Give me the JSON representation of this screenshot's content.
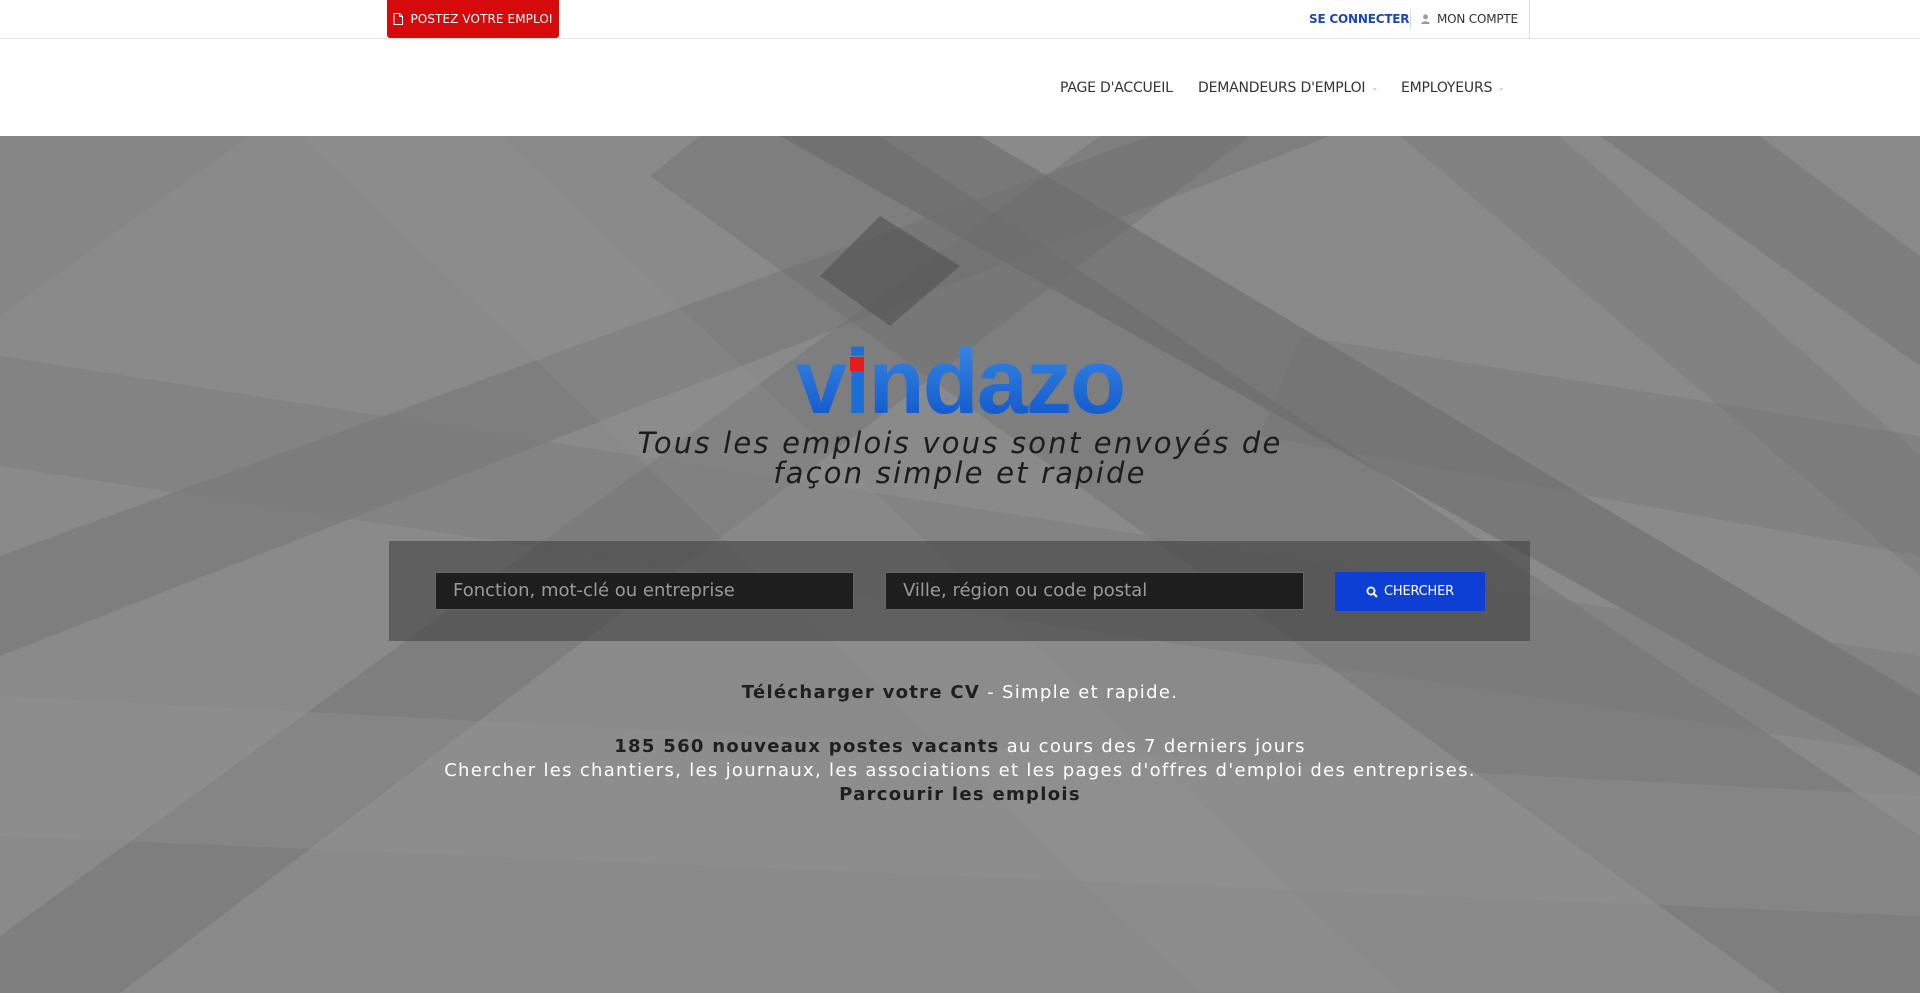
{
  "topbar": {
    "post_job_label": "POSTEZ VOTRE EMPLOI",
    "post_job_icon": "document-icon",
    "login_label": "SE CONNECTER",
    "account_label": "MON COMPTE",
    "account_icon": "user-icon"
  },
  "nav": {
    "items": [
      {
        "label": "PAGE D'ACCUEIL",
        "has_dropdown": false
      },
      {
        "label": "DEMANDEURS D'EMPLOI",
        "has_dropdown": true
      },
      {
        "label": "EMPLOYEURS",
        "has_dropdown": true
      }
    ]
  },
  "hero": {
    "logo": {
      "text_pre": "v",
      "text_i": "i",
      "text_post": "ndazo",
      "color": "#1b6fd6",
      "dot_color": "#e61b1b"
    },
    "tagline_line1": "Tous les emplois vous sont envoyés de",
    "tagline_line2": "façon simple et rapide"
  },
  "search": {
    "keyword_placeholder": "Fonction, mot-clé ou entreprise",
    "location_placeholder": "Ville, région ou code postal",
    "button_label": "CHERCHER",
    "button_icon": "search-icon",
    "button_color": "#0d3fd4"
  },
  "info": {
    "upload_cv_link": "Télécharger votre CV",
    "upload_cv_suffix": " - Simple et rapide.",
    "vacancies_bold": "185 560 nouveaux postes vacants",
    "vacancies_suffix": " au cours des 7 derniers jours",
    "description": "Chercher les chantiers, les journaux, les associations et les pages d'offres d'emploi des entreprises.",
    "browse_link": "Parcourir les emplois"
  },
  "colors": {
    "brand_red": "#d60a0a",
    "link_blue": "#1a46b8"
  }
}
